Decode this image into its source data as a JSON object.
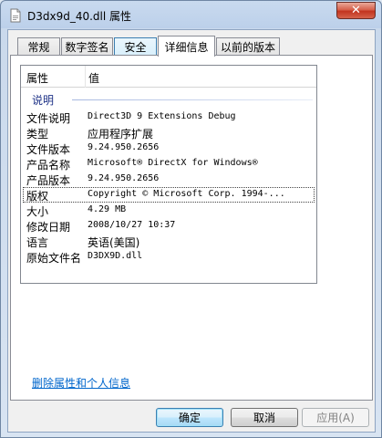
{
  "window": {
    "title": "D3dx9d_40.dll 属性",
    "close_symbol": "✕"
  },
  "tabs": [
    {
      "label": "常规",
      "active": false
    },
    {
      "label": "数字签名",
      "active": false
    },
    {
      "label": "安全",
      "active": false
    },
    {
      "label": "详细信息",
      "active": true
    },
    {
      "label": "以前的版本",
      "active": false
    }
  ],
  "details": {
    "columns": {
      "property": "属性",
      "value": "值"
    },
    "group_label": "说明",
    "rows": [
      {
        "property": "文件说明",
        "value": "Direct3D 9 Extensions Debug"
      },
      {
        "property": "类型",
        "value": "应用程序扩展"
      },
      {
        "property": "文件版本",
        "value": "9.24.950.2656"
      },
      {
        "property": "产品名称",
        "value": "Microsoft® DirectX for Windows®"
      },
      {
        "property": "产品版本",
        "value": "9.24.950.2656"
      },
      {
        "property": "版权",
        "value": "Copyright © Microsoft Corp. 1994-..."
      },
      {
        "property": "大小",
        "value": "4.29 MB"
      },
      {
        "property": "修改日期",
        "value": "2008/10/27 10:37"
      },
      {
        "property": "语言",
        "value": "英语(美国)"
      },
      {
        "property": "原始文件名",
        "value": "D3DX9D.dll"
      }
    ],
    "focused_row": 5
  },
  "remove_link": "删除属性和个人信息",
  "buttons": {
    "ok": "确定",
    "cancel": "取消",
    "apply": "应用(A)"
  },
  "icons": {
    "title_icon": "document-icon"
  }
}
